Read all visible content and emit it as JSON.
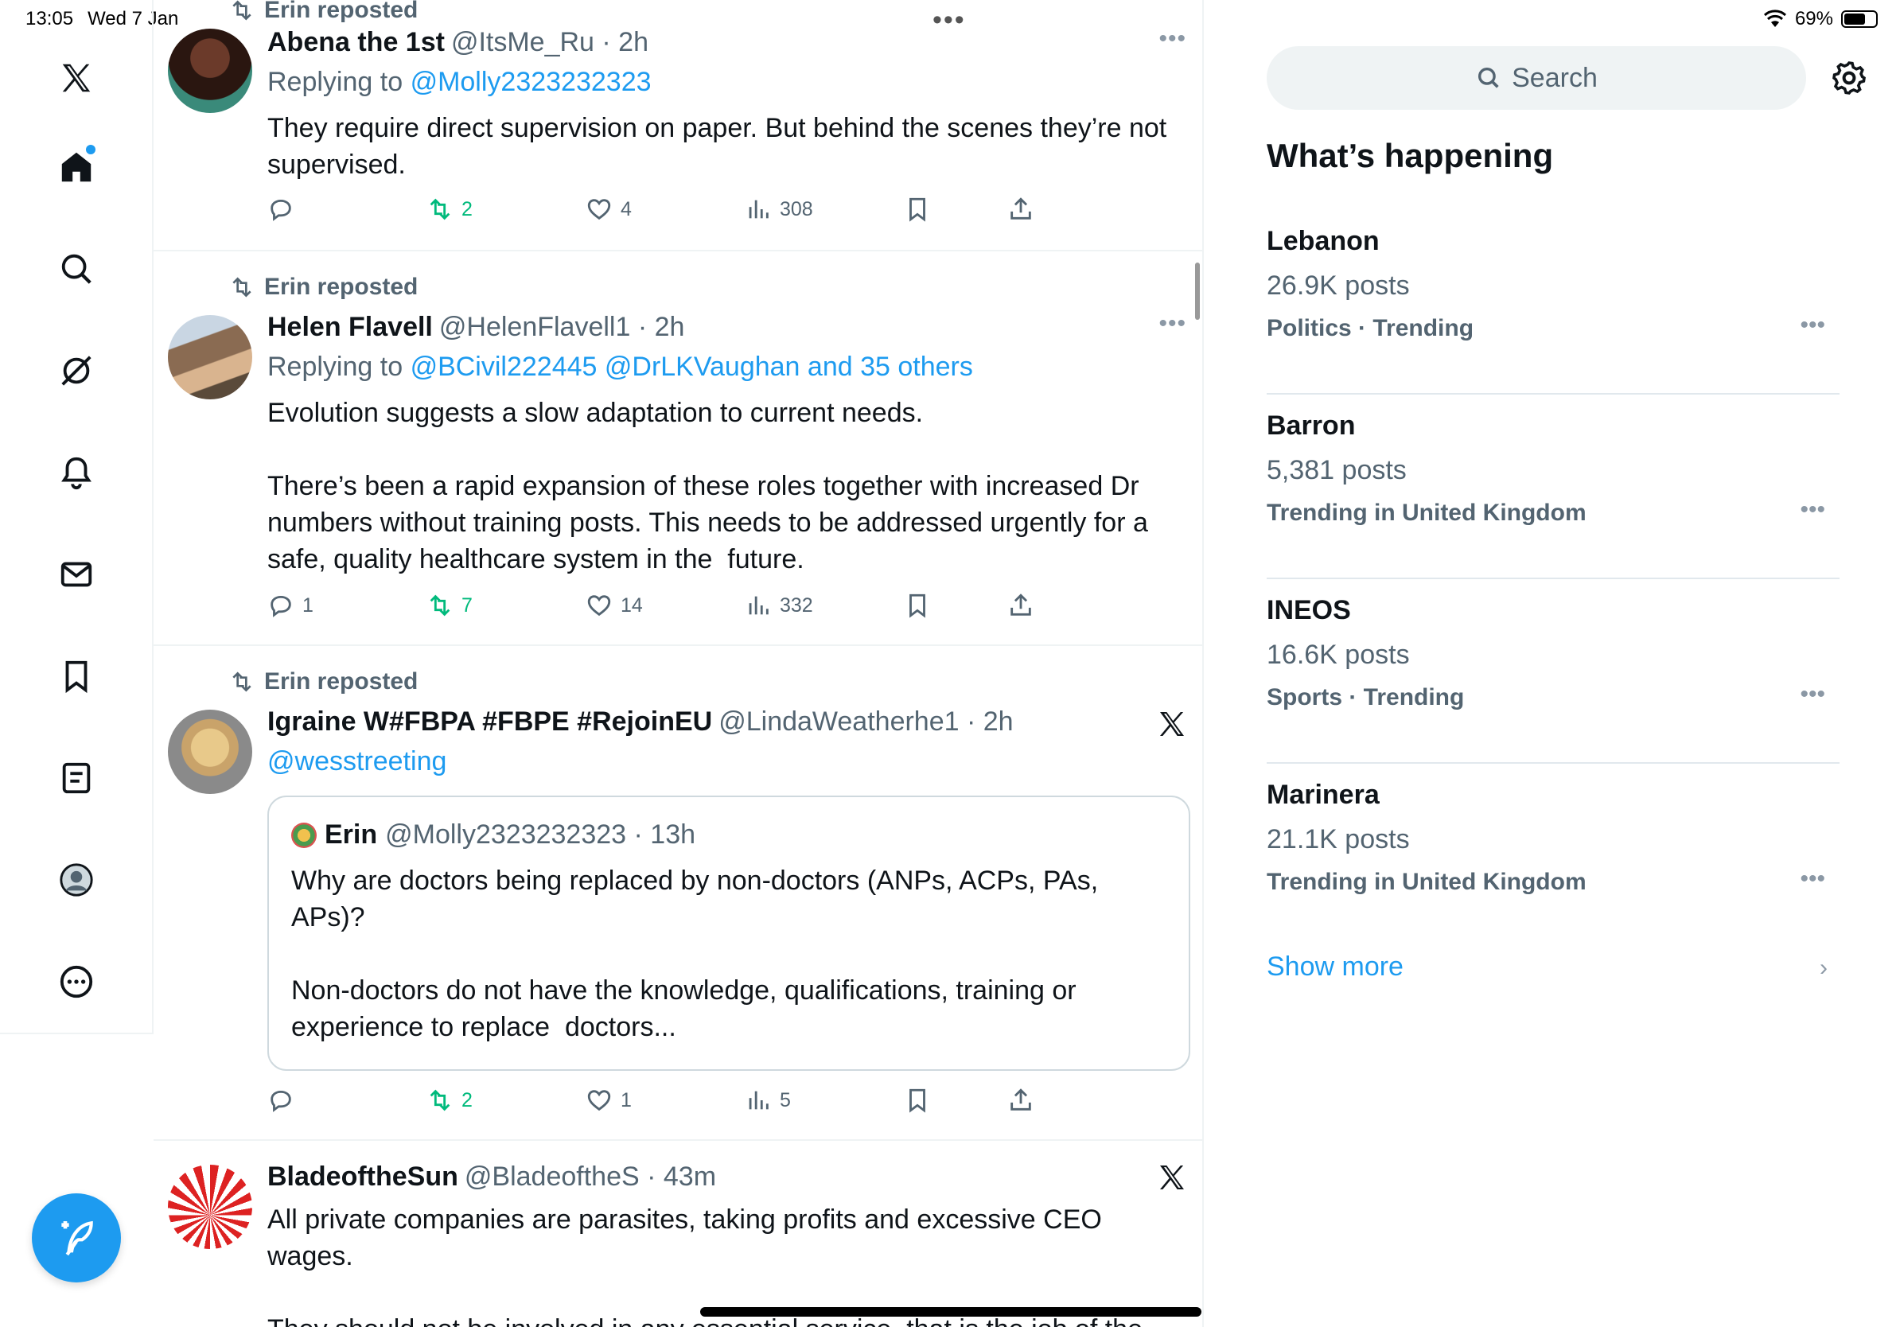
{
  "status_bar": {
    "time": "13:05",
    "date": "Wed 7 Jan",
    "battery": "69%",
    "battery_level": 0.69
  },
  "nav": {
    "items": [
      {
        "name": "x-logo-icon"
      },
      {
        "name": "home-icon",
        "active": true,
        "has_dot": true
      },
      {
        "name": "search-icon"
      },
      {
        "name": "grok-icon"
      },
      {
        "name": "notifications-icon"
      },
      {
        "name": "messages-icon"
      },
      {
        "name": "bookmarks-icon"
      },
      {
        "name": "lists-icon"
      },
      {
        "name": "profile-icon"
      },
      {
        "name": "more-icon"
      }
    ],
    "compose": {
      "name": "compose-icon",
      "color": "#1d9bf0"
    }
  },
  "feed": {
    "tweets": [
      {
        "repost_by": "Erin reposted",
        "name": "Abena the 1st",
        "handle": "@ItsMe_Ru · 2h",
        "reply_prefix": "Replying to",
        "reply_to": "@Molly2323232323",
        "text": "They require direct supervision on paper. But behind the scenes they’re not supervised.",
        "replies": "",
        "reposts": "2",
        "likes": "4",
        "views": "308"
      },
      {
        "repost_by": "Erin reposted",
        "name": "Helen Flavell",
        "handle": "@HelenFlavell1 · 2h",
        "reply_prefix": "Replying to",
        "reply_to": "@BCivil222445 @DrLKVaughan and 35 others",
        "text": "Evolution suggests a slow adaptation to current needs.\n\nThere’s been a rapid expansion of these roles together with increased Dr numbers without training posts. This needs to be addressed urgently for a safe, quality healthcare system in the  future.",
        "replies": "1",
        "reposts": "7",
        "likes": "14",
        "views": "332"
      },
      {
        "repost_by": "Erin reposted",
        "name": "Igraine W#FBPA #FBPE #RejoinEU",
        "handle": "@LindaWeatherhe1 · 2h",
        "mention": "@wesstreeting",
        "quote": {
          "name": "Erin",
          "handle": "@Molly2323232323 · 13h",
          "text": "Why are doctors being replaced by non-doctors (ANPs, ACPs, PAs, APs)?\n\nNon-doctors do not have the knowledge, qualifications, training or experience to replace  doctors..."
        },
        "replies": "",
        "reposts": "2",
        "likes": "1",
        "views": "5"
      },
      {
        "name": "BladeoftheSun",
        "handle": "@BladeoftheS · 43m",
        "text": "All private companies are parasites, taking profits and excessive CEO wages.\n\nThey should not be involved in any essential service, that is the job of the"
      }
    ]
  },
  "sidebar": {
    "search_placeholder": "Search",
    "section_title": "What’s happening",
    "trends": [
      {
        "name": "Lebanon",
        "count": "26.9K posts",
        "category": "Politics · Trending"
      },
      {
        "name": "Barron",
        "count": "5,381 posts",
        "category": "Trending in United Kingdom"
      },
      {
        "name": "INEOS",
        "count": "16.6K posts",
        "category": "Sports · Trending"
      },
      {
        "name": "Marinera",
        "count": "21.1K posts",
        "category": "Trending in United Kingdom"
      }
    ],
    "show_more": "Show more"
  },
  "colors": {
    "accent": "#1d9bf0",
    "repost_green": "#00ba7c",
    "muted": "#536471"
  }
}
